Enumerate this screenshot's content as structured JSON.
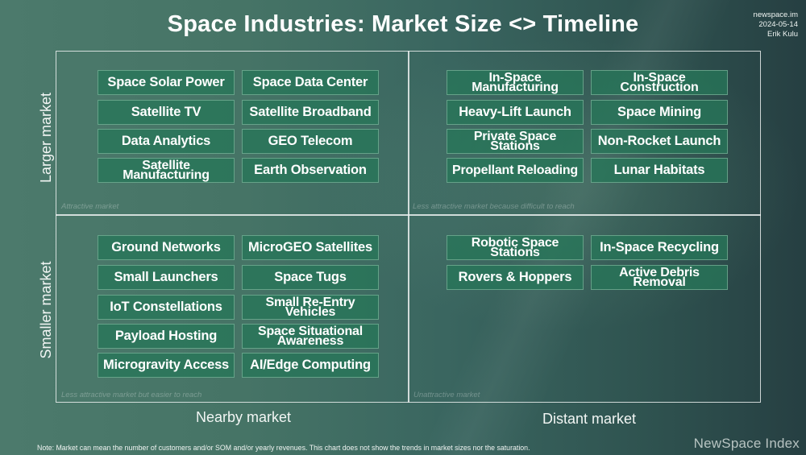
{
  "title": "Space Industries: Market Size <> Timeline",
  "meta": {
    "site": "newspace.im",
    "date": "2024-05-14",
    "author": "Erik Kulu"
  },
  "axes": {
    "y_top": "Larger market",
    "y_bottom": "Smaller market",
    "x_left": "Nearby market",
    "x_right": "Distant market"
  },
  "quadrants": {
    "top_left": {
      "note": "Attractive market",
      "items": [
        "Space Solar Power",
        "Space Data Center",
        "Satellite TV",
        "Satellite Broadband",
        "Data Analytics",
        "GEO Telecom",
        "Satellite Manufacturing",
        "Earth Observation"
      ]
    },
    "top_right": {
      "note": "Less attractive market because difficult to reach",
      "items": [
        "In-Space Manufacturing",
        "In-Space Construction",
        "Heavy-Lift Launch",
        "Space Mining",
        "Private Space Stations",
        "Non-Rocket Launch",
        "Propellant Reloading",
        "Lunar Habitats"
      ]
    },
    "bottom_left": {
      "note": "Less attractive market but easier to reach",
      "items": [
        "Ground Networks",
        "MicroGEO Satellites",
        "Small Launchers",
        "Space Tugs",
        "IoT Constellations",
        "Small Re-Entry Vehicles",
        "Payload Hosting",
        "Space Situational Awareness",
        "Microgravity Access",
        "AI/Edge Computing"
      ]
    },
    "bottom_right": {
      "note": "Unattractive market",
      "items": [
        "Robotic Space Stations",
        "In-Space Recycling",
        "Rovers & Hoppers",
        "Active Debris Removal"
      ]
    }
  },
  "footnote": "Note: Market can mean the number of customers and/or SOM and/or yearly revenues. This chart does not show the trends in market sizes nor the saturation.",
  "brand": "NewSpace Index",
  "colors": {
    "box_fill": "#2a7658",
    "box_border": "#8fc2a8",
    "frame": "#e6ece9"
  }
}
